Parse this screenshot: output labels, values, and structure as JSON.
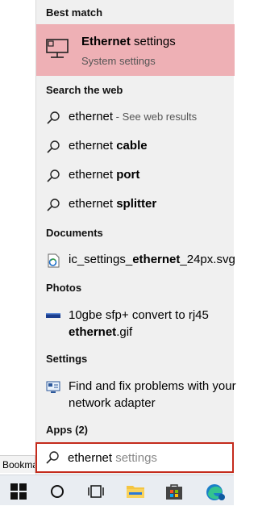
{
  "background": {
    "bookmark_tab": "Bookma"
  },
  "panel": {
    "best_match_header": "Best match",
    "best_match": {
      "title_bold": "Ethernet",
      "title_rest": " settings",
      "subtitle": "System settings"
    },
    "search_web_header": "Search the web",
    "web_results": [
      {
        "prefix": "ethernet",
        "bold": "",
        "suffix": " - See web results"
      },
      {
        "prefix": "ethernet ",
        "bold": "cable",
        "suffix": ""
      },
      {
        "prefix": "ethernet ",
        "bold": "port",
        "suffix": ""
      },
      {
        "prefix": "ethernet ",
        "bold": "splitter",
        "suffix": ""
      }
    ],
    "documents_header": "Documents",
    "document": {
      "prefix": "ic_settings_",
      "bold": "ethernet",
      "suffix": "_24px.svg"
    },
    "photos_header": "Photos",
    "photo": {
      "line1": "10gbe sfp+ convert to rj45",
      "line2_bold": "ethernet",
      "line2_rest": ".gif"
    },
    "settings_header": "Settings",
    "setting": {
      "line1": "Find and fix problems with your",
      "line2": "network adapter"
    },
    "apps_header": "Apps (2)"
  },
  "search": {
    "typed": "ethernet",
    "suggestion": " settings"
  },
  "taskbar": {
    "items": [
      "start-button",
      "search-circle",
      "task-view",
      "file-explorer",
      "microsoft-store",
      "edge-browser"
    ]
  },
  "colors": {
    "highlight": "#eeb0b5",
    "search_border": "#c42b1c",
    "panel_bg": "#f0f0f0"
  }
}
